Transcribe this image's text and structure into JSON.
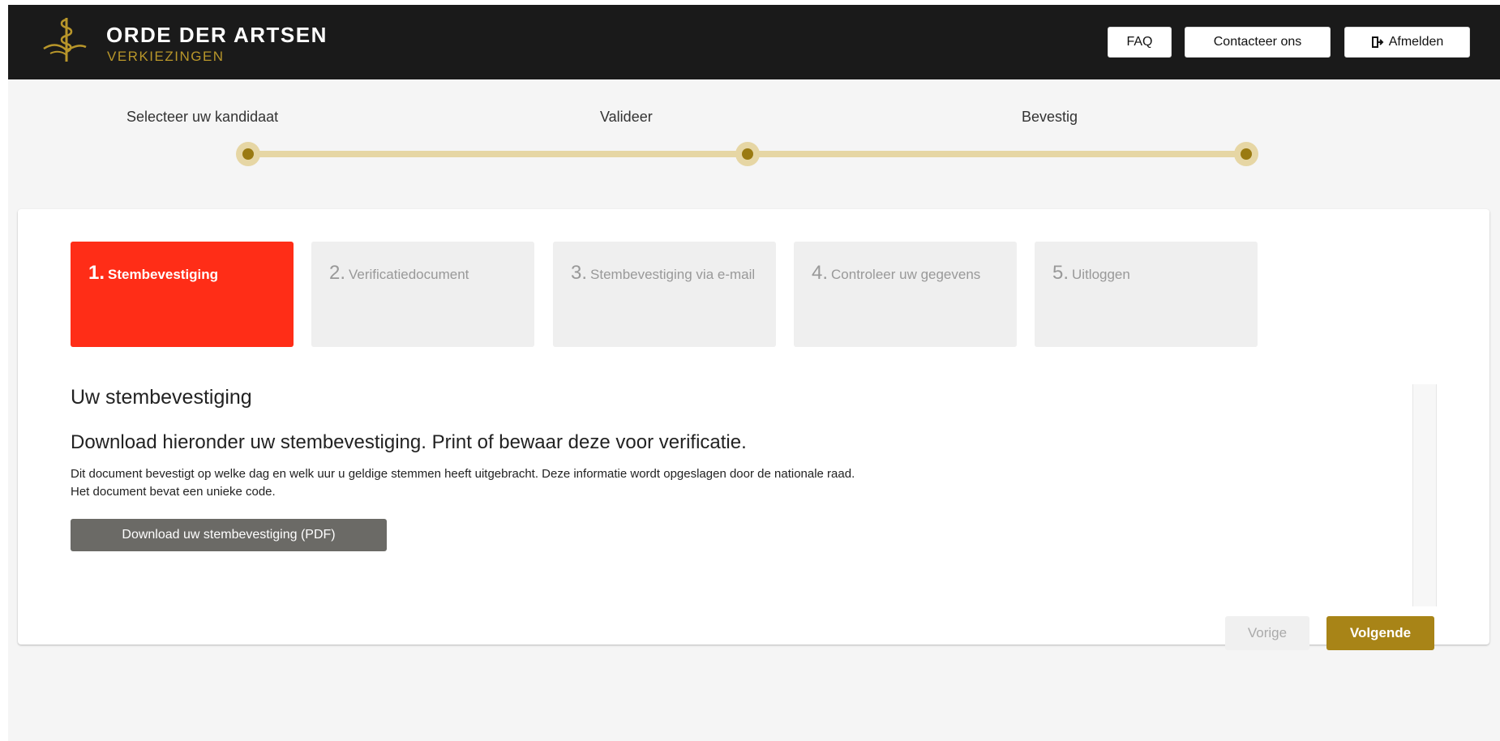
{
  "brand": {
    "title": "ORDE DER ARTSEN",
    "subtitle": "VERKIEZINGEN"
  },
  "header": {
    "faq_label": "FAQ",
    "contact_label": "Contacteer ons",
    "logout_label": "Afmelden"
  },
  "progress": {
    "steps": [
      {
        "label": "Selecteer uw kandidaat"
      },
      {
        "label": "Valideer"
      },
      {
        "label": "Bevestig"
      }
    ]
  },
  "tabs": [
    {
      "num": "1.",
      "label": "Stembevestiging",
      "active": true
    },
    {
      "num": "2.",
      "label": "Verificatiedocument",
      "active": false
    },
    {
      "num": "3.",
      "label": "Stembevestiging via e-mail",
      "active": false
    },
    {
      "num": "4.",
      "label": "Controleer uw gegevens",
      "active": false
    },
    {
      "num": "5.",
      "label": "Uitloggen",
      "active": false
    }
  ],
  "content": {
    "title": "Uw stembevestiging",
    "subtitle": "Download hieronder uw stembevestiging. Print of bewaar deze voor verificatie.",
    "description_line1": "Dit document bevestigt op welke dag en welk uur u geldige stemmen heeft uitgebracht. Deze informatie wordt opgeslagen door de nationale raad.",
    "description_line2": "Het document bevat een unieke code.",
    "download_label": "Download uw stembevestiging (PDF)"
  },
  "navigation": {
    "prev_label": "Vorige",
    "next_label": "Volgende"
  },
  "colors": {
    "header_bg": "#1a1a1a",
    "brand_gold": "#b8962a",
    "active_tab": "#ff2d17",
    "next_button": "#a88417",
    "download_button": "#6b6a66",
    "progress_track": "#e6d6a4"
  }
}
